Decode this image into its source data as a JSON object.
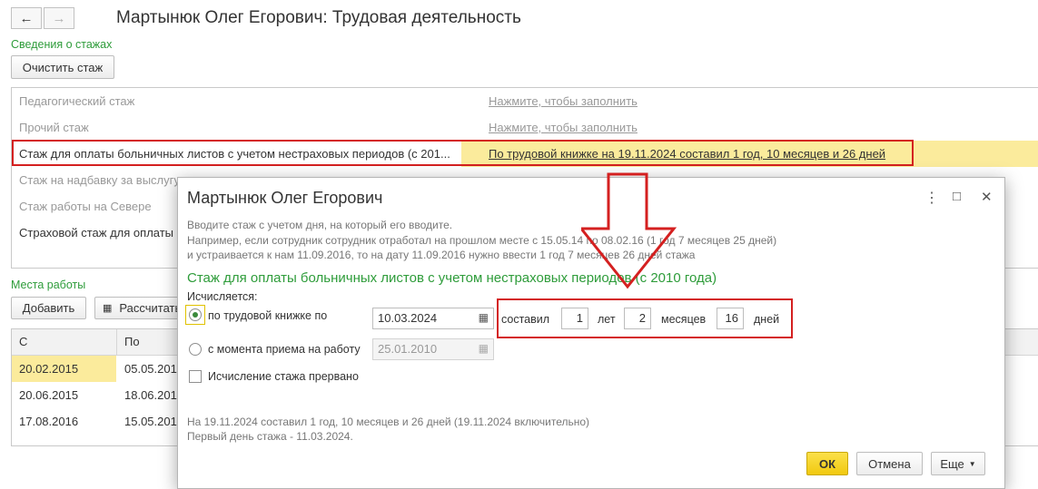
{
  "window": {
    "title": "Мартынюк Олег Егорович: Трудовая деятельность",
    "back_icon": "←",
    "forward_icon": "→"
  },
  "experience": {
    "section_label": "Сведения о стажах",
    "clear_button": "Очистить стаж",
    "rows": [
      {
        "name": "Педагогический стаж",
        "value": "Нажмите, чтобы заполнить"
      },
      {
        "name": "Прочий стаж",
        "value": "Нажмите, чтобы заполнить"
      },
      {
        "name": "Стаж для оплаты больничных листов с учетом нестраховых периодов (с 201...",
        "value": "По трудовой книжке на 19.11.2024 составил 1 год, 10 месяцев и 26 дней"
      },
      {
        "name": "Стаж на надбавку за выслугу",
        "value": ""
      },
      {
        "name": "Стаж работы на Севере",
        "value": ""
      },
      {
        "name": "Страховой стаж для оплаты б",
        "value": ""
      }
    ]
  },
  "workplaces": {
    "section_label": "Места работы",
    "add_button": "Добавить",
    "calc_button": "Рассчитать",
    "columns": [
      "С",
      "По"
    ],
    "rows": [
      {
        "from": "20.02.2015",
        "to": "05.05.201"
      },
      {
        "from": "20.06.2015",
        "to": "18.06.201"
      },
      {
        "from": "17.08.2016",
        "to": "15.05.201"
      }
    ]
  },
  "dialog": {
    "title": "Мартынюк Олег Егорович",
    "hint_line1": "Вводите стаж с учетом дня, на который его вводите.",
    "hint_line2": "Например, если сотрудник сотрудник отработал на прошлом месте с 15.05.14 по 08.02.16 (1 год 7 месяцев 25 дней)",
    "hint_line3": "и устраивается к нам 11.09.2016, то на дату 11.09.2016 нужно ввести 1 год 7 месяцев 26 дней стажа",
    "heading": "Стаж для оплаты больничных листов с учетом нестраховых периодов (с 2010 года)",
    "calc_label": "Исчисляется:",
    "option_book": "по трудовой книжке по",
    "book_date": "10.03.2024",
    "option_hire": "с момента приема на работу",
    "hire_date": "25.01.2010",
    "interrupted_label": "Исчисление стажа прервано",
    "sostavil": "составил",
    "years": "1",
    "years_label": "лет",
    "months": "2",
    "months_label": "месяцев",
    "days": "16",
    "days_label": "дней",
    "summary_line1": "На 19.11.2024 составил 1 год, 10 месяцев и 26 дней (19.11.2024 включительно)",
    "summary_line2": "Первый день стажа - 11.03.2024.",
    "ok_button": "ОК",
    "cancel_button": "Отмена",
    "more_button": "Еще",
    "menu_icon": "⋮",
    "maximize_icon": "□",
    "close_icon": "✕"
  },
  "colors": {
    "green": "#2e9c3a",
    "highlight": "#fbeb9c",
    "annotation_red": "#d42020",
    "ok_yellow": "#f7d21b"
  }
}
